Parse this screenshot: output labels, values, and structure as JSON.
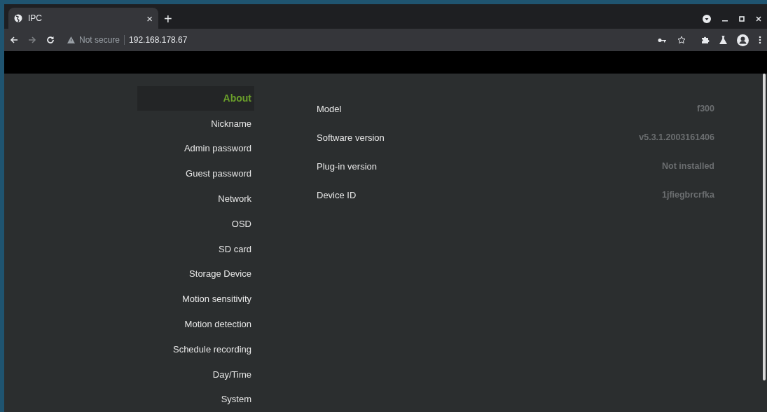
{
  "browser": {
    "tab_title": "IPC",
    "tab_close": "×",
    "new_tab": "+",
    "security_label": "Not secure",
    "url": "192.168.178.67"
  },
  "sidebar": {
    "items": [
      {
        "label": "About",
        "selected": true
      },
      {
        "label": "Nickname",
        "selected": false
      },
      {
        "label": "Admin password",
        "selected": false
      },
      {
        "label": "Guest password",
        "selected": false
      },
      {
        "label": "Network",
        "selected": false
      },
      {
        "label": "OSD",
        "selected": false
      },
      {
        "label": "SD card",
        "selected": false
      },
      {
        "label": "Storage Device",
        "selected": false
      },
      {
        "label": "Motion sensitivity",
        "selected": false
      },
      {
        "label": "Motion detection",
        "selected": false
      },
      {
        "label": "Schedule recording",
        "selected": false
      },
      {
        "label": "Day/Time",
        "selected": false
      },
      {
        "label": "System",
        "selected": false
      }
    ]
  },
  "about": [
    {
      "label": "Model",
      "value": "f300"
    },
    {
      "label": "Software version",
      "value": "v5.3.1.2003161406"
    },
    {
      "label": "Plug-in version",
      "value": "Not installed"
    },
    {
      "label": "Device ID",
      "value": "1jfiegbrcrfka"
    }
  ]
}
